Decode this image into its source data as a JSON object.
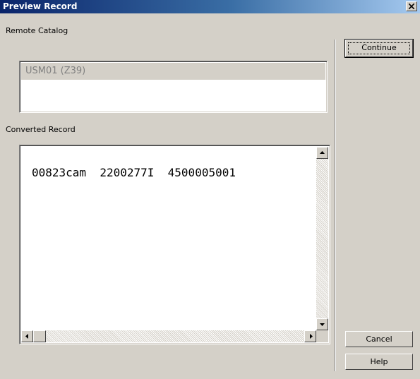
{
  "window": {
    "title": "Preview Record",
    "close_icon": "close-icon"
  },
  "remote_catalog": {
    "label": "Remote Catalog",
    "selected_item": "USM01 (Z39)"
  },
  "converted_record": {
    "label": "Converted Record",
    "text": "00823cam  2200277I  4500005001"
  },
  "buttons": {
    "continue_label": "Continue",
    "cancel_label": "Cancel",
    "help_label": "Help"
  },
  "colors": {
    "titlebar_start": "#0a246a",
    "titlebar_end": "#a6caf0",
    "dialog_face": "#d4d0c8"
  }
}
